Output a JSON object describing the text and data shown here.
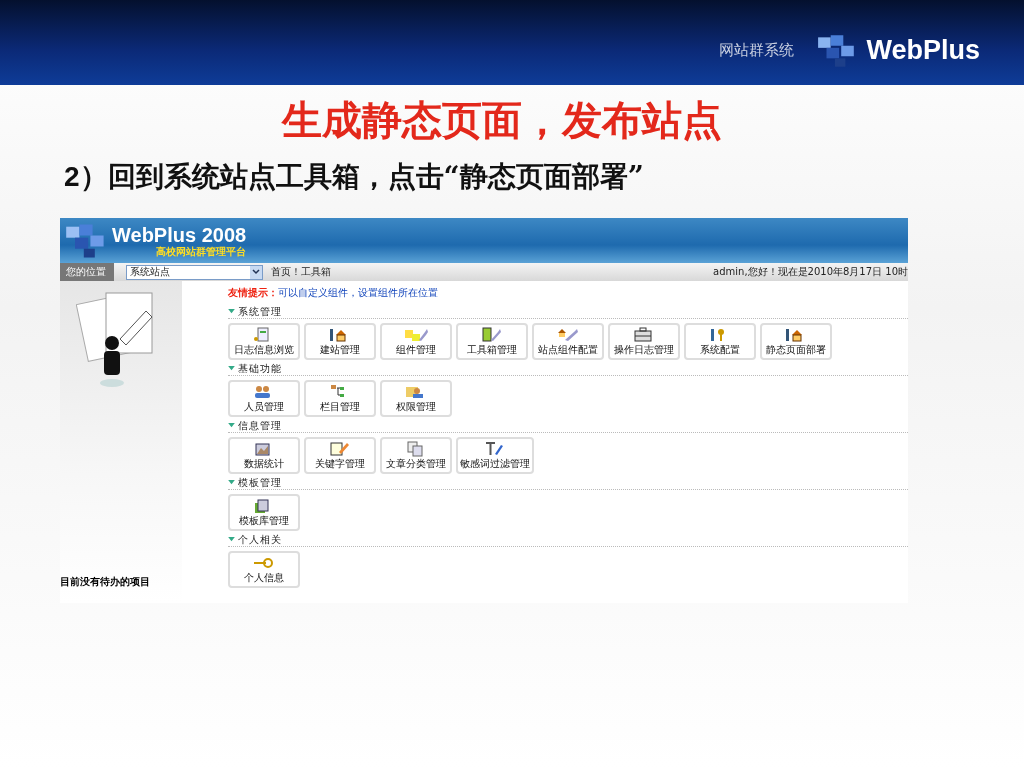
{
  "header": {
    "system_label": "网站群系统",
    "brand": "WebPlus"
  },
  "title": "生成静态页面，发布站点",
  "step": {
    "number": "2",
    "text": "）回到系统站点工具箱，点击“静态页面部署”"
  },
  "app": {
    "brand": "WebPlus 2008",
    "tagline": "高校网站群管理平台",
    "location_label": "您的位置",
    "site_select": "系统站点",
    "breadcrumb": "首页！工具箱",
    "user_info": "admin,您好！现在是2010年8月17日  10时",
    "tip_label": "友情提示：",
    "tip_text": "可以自定义组件，设置组件所在位置",
    "sections": [
      {
        "title": "系统管理",
        "tools": [
          {
            "label": "日志信息浏览",
            "kind": "log"
          },
          {
            "label": "建站管理",
            "kind": "build"
          },
          {
            "label": "组件管理",
            "kind": "component"
          },
          {
            "label": "工具箱管理",
            "kind": "toolbox"
          },
          {
            "label": "站点组件配置",
            "kind": "siteconfig"
          },
          {
            "label": "操作日志管理",
            "kind": "oplog"
          },
          {
            "label": "系统配置",
            "kind": "sysconfig"
          },
          {
            "label": "静态页面部署",
            "kind": "build"
          }
        ]
      },
      {
        "title": "基础功能",
        "tools": [
          {
            "label": "人员管理",
            "kind": "people"
          },
          {
            "label": "栏目管理",
            "kind": "column"
          },
          {
            "label": "权限管理",
            "kind": "permission"
          }
        ]
      },
      {
        "title": "信息管理",
        "tools": [
          {
            "label": "数据统计",
            "kind": "stats"
          },
          {
            "label": "关键字管理",
            "kind": "keyword"
          },
          {
            "label": "文章分类管理",
            "kind": "category"
          },
          {
            "label": "敏感词过滤管理",
            "kind": "filter"
          }
        ]
      },
      {
        "title": "模板管理",
        "tools": [
          {
            "label": "模板库管理",
            "kind": "template"
          }
        ]
      },
      {
        "title": "个人相关",
        "tools": [
          {
            "label": "个人信息",
            "kind": "key"
          }
        ]
      }
    ],
    "todo": "目前没有待办的项目"
  }
}
